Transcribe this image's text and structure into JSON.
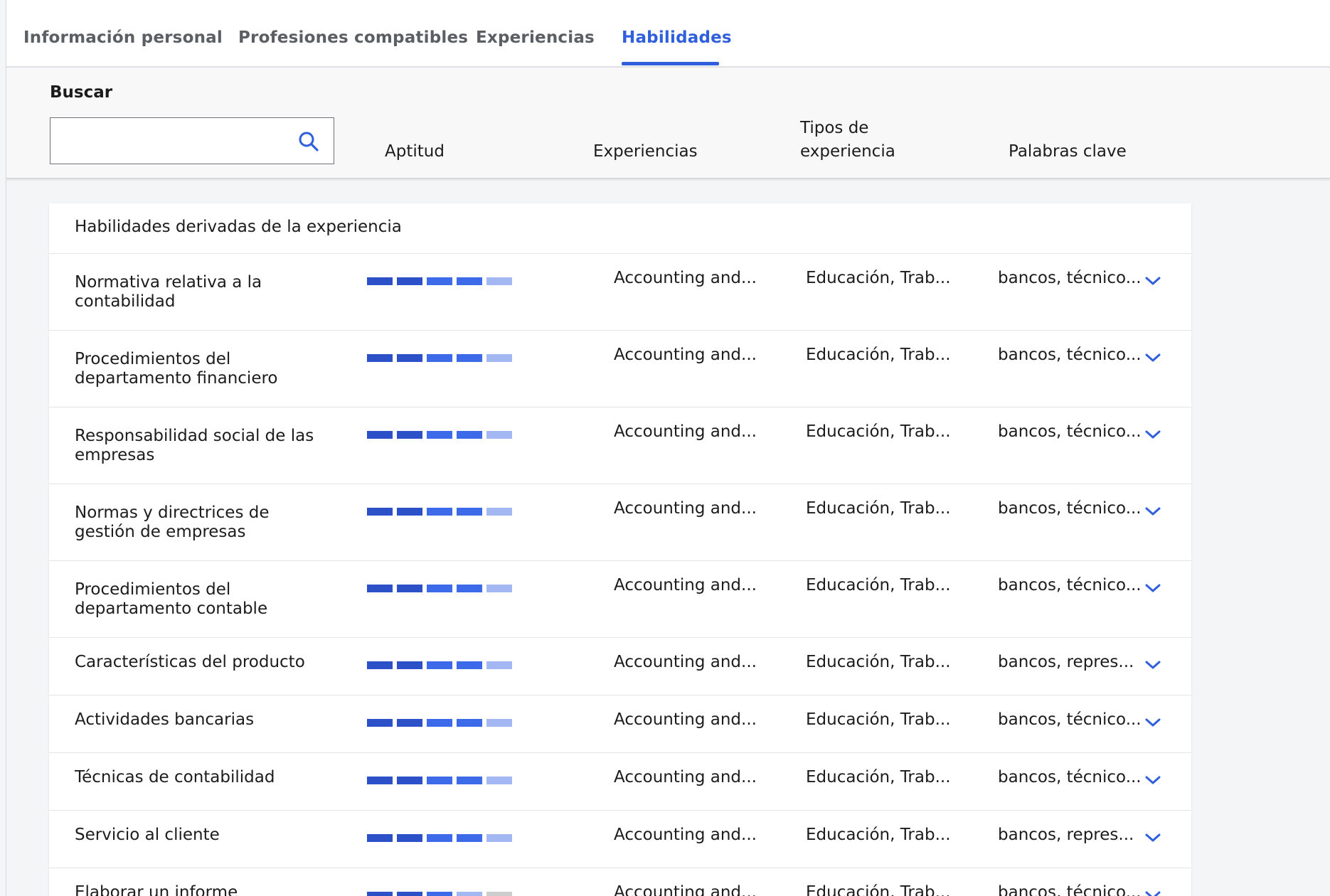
{
  "tabs": [
    {
      "label": "Información personal",
      "active": false
    },
    {
      "label": "Profesiones compatibles",
      "active": false
    },
    {
      "label": "Experiencias",
      "active": false
    },
    {
      "label": "Habilidades",
      "active": true
    }
  ],
  "search": {
    "label": "Buscar",
    "value": "",
    "placeholder": ""
  },
  "columns": {
    "aptitude": "Aptitud",
    "experiences": "Experiencias",
    "experience_types_line1": "Tipos de",
    "experience_types_line2": "experiencia",
    "keywords": "Palabras clave"
  },
  "card": {
    "title": "Habilidades derivadas de la experiencia",
    "rows": [
      {
        "name": "Normativa relativa a la contabilidad",
        "aptitude_level": 4,
        "aptitude_max": 5,
        "experiences": "Accounting and...",
        "types": "Educación, Trab...",
        "keywords": "bancos, técnico..."
      },
      {
        "name": "Procedimientos del departamento financiero",
        "aptitude_level": 4,
        "aptitude_max": 5,
        "experiences": "Accounting and...",
        "types": "Educación, Trab...",
        "keywords": "bancos, técnico..."
      },
      {
        "name": "Responsabilidad social de las empresas",
        "aptitude_level": 4,
        "aptitude_max": 5,
        "experiences": "Accounting and...",
        "types": "Educación, Trab...",
        "keywords": "bancos, técnico..."
      },
      {
        "name": "Normas y directrices de gestión de empresas",
        "aptitude_level": 4,
        "aptitude_max": 5,
        "experiences": "Accounting and...",
        "types": "Educación, Trab...",
        "keywords": "bancos, técnico..."
      },
      {
        "name": "Procedimientos del departamento contable",
        "aptitude_level": 4,
        "aptitude_max": 5,
        "experiences": "Accounting and...",
        "types": "Educación, Trab...",
        "keywords": "bancos, técnico..."
      },
      {
        "name": "Características del producto",
        "aptitude_level": 4,
        "aptitude_max": 5,
        "experiences": "Accounting and...",
        "types": "Educación, Trab...",
        "keywords": "bancos, repres..."
      },
      {
        "name": "Actividades bancarias",
        "aptitude_level": 4,
        "aptitude_max": 5,
        "experiences": "Accounting and...",
        "types": "Educación, Trab...",
        "keywords": "bancos, técnico..."
      },
      {
        "name": "Técnicas de contabilidad",
        "aptitude_level": 4,
        "aptitude_max": 5,
        "experiences": "Accounting and...",
        "types": "Educación, Trab...",
        "keywords": "bancos, técnico..."
      },
      {
        "name": "Servicio al cliente",
        "aptitude_level": 4,
        "aptitude_max": 5,
        "experiences": "Accounting and...",
        "types": "Educación, Trab...",
        "keywords": "bancos, repres..."
      },
      {
        "name": "Elaborar un informe",
        "aptitude_level": 3,
        "aptitude_max": 5,
        "experiences": "Accounting and...",
        "types": "Educación, Trab...",
        "keywords": "bancos, técnico..."
      }
    ]
  },
  "colors": {
    "accent": "#2f5fdc",
    "bar_strong": "#2b50c7",
    "bar_mid": "#3d6ae8",
    "bar_light": "#a3b8f3",
    "bar_empty": "#cdcdcd"
  },
  "icons": {
    "search": "search-icon",
    "expand": "chevron-down-icon"
  }
}
